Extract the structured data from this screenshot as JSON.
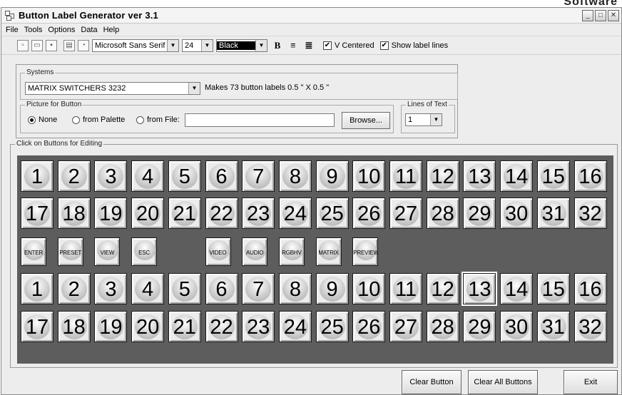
{
  "corner_text": "Software",
  "window": {
    "title": "Button Label Generator   ver 3.1"
  },
  "menu": [
    "File",
    "Tools",
    "Options",
    "Data",
    "Help"
  ],
  "toolbar": {
    "font": "Microsoft Sans Serif",
    "size": "24",
    "color": "Black",
    "bold": "B",
    "v_centered": "V Centered",
    "show_label_lines": "Show label lines"
  },
  "systems": {
    "label": "Systems",
    "selected": "MATRIX SWITCHERS 3232",
    "info": "Makes 73 button labels 0.5 \" X 0.5 \""
  },
  "picture": {
    "label": "Picture for Button",
    "none": "None",
    "palette": "from Palette",
    "file": "from File:",
    "file_value": "",
    "browse": "Browse..."
  },
  "lines": {
    "label": "Lines of Text",
    "value": "1"
  },
  "grid": {
    "label": "Click on Buttons for Editing",
    "row1": [
      "1",
      "2",
      "3",
      "4",
      "5",
      "6",
      "7",
      "8",
      "9",
      "10",
      "11",
      "12",
      "13",
      "14",
      "15",
      "16"
    ],
    "row2": [
      "17",
      "18",
      "19",
      "20",
      "21",
      "22",
      "23",
      "24",
      "25",
      "26",
      "27",
      "28",
      "29",
      "30",
      "31",
      "32"
    ],
    "special_left": [
      "ENTER",
      "PRESET",
      "VIEW",
      "ESC"
    ],
    "special_right": [
      "VIDEO",
      "AUDIO",
      "RGBHV",
      "MATRIX",
      "PREVIEW"
    ],
    "row4": [
      "1",
      "2",
      "3",
      "4",
      "5",
      "6",
      "7",
      "8",
      "9",
      "10",
      "11",
      "12",
      "13",
      "14",
      "15",
      "16"
    ],
    "row5": [
      "17",
      "18",
      "19",
      "20",
      "21",
      "22",
      "23",
      "24",
      "25",
      "26",
      "27",
      "28",
      "29",
      "30",
      "31",
      "32"
    ],
    "selected_label": "13"
  },
  "buttons": {
    "clear": "Clear Button",
    "clear_all": "Clear All Buttons",
    "exit": "Exit"
  }
}
